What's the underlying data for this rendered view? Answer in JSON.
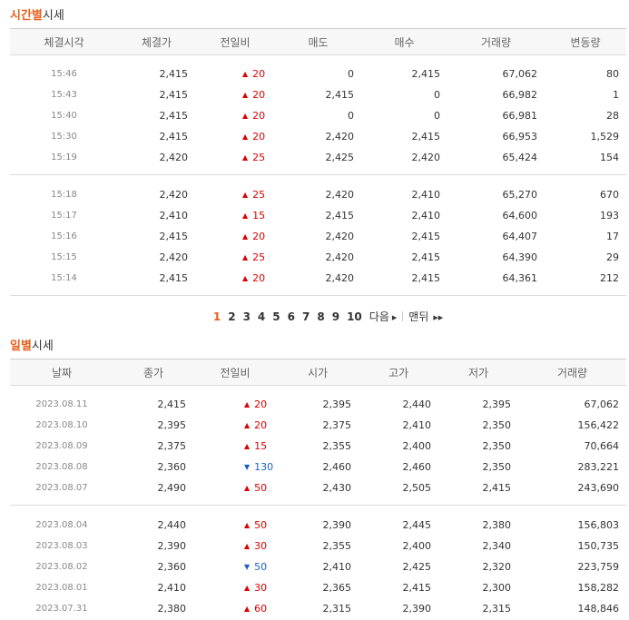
{
  "hourly": {
    "title_accent": "시간별",
    "title_rest": "시세",
    "headers": [
      "체결시각",
      "체결가",
      "전일비",
      "매도",
      "매수",
      "거래량",
      "변동량"
    ],
    "group1": [
      {
        "time": "15:46",
        "price": "2,415",
        "dir": "up",
        "chg": "20",
        "ask": "0",
        "bid": "2,415",
        "vol": "67,062",
        "delta": "80"
      },
      {
        "time": "15:43",
        "price": "2,415",
        "dir": "up",
        "chg": "20",
        "ask": "2,415",
        "bid": "0",
        "vol": "66,982",
        "delta": "1"
      },
      {
        "time": "15:40",
        "price": "2,415",
        "dir": "up",
        "chg": "20",
        "ask": "0",
        "bid": "0",
        "vol": "66,981",
        "delta": "28"
      },
      {
        "time": "15:30",
        "price": "2,415",
        "dir": "up",
        "chg": "20",
        "ask": "2,420",
        "bid": "2,415",
        "vol": "66,953",
        "delta": "1,529"
      },
      {
        "time": "15:19",
        "price": "2,420",
        "dir": "up",
        "chg": "25",
        "ask": "2,425",
        "bid": "2,420",
        "vol": "65,424",
        "delta": "154"
      }
    ],
    "group2": [
      {
        "time": "15:18",
        "price": "2,420",
        "dir": "up",
        "chg": "25",
        "ask": "2,420",
        "bid": "2,410",
        "vol": "65,270",
        "delta": "670"
      },
      {
        "time": "15:17",
        "price": "2,410",
        "dir": "up",
        "chg": "15",
        "ask": "2,415",
        "bid": "2,410",
        "vol": "64,600",
        "delta": "193"
      },
      {
        "time": "15:16",
        "price": "2,415",
        "dir": "up",
        "chg": "20",
        "ask": "2,420",
        "bid": "2,415",
        "vol": "64,407",
        "delta": "17"
      },
      {
        "time": "15:15",
        "price": "2,420",
        "dir": "up",
        "chg": "25",
        "ask": "2,420",
        "bid": "2,415",
        "vol": "64,390",
        "delta": "29"
      },
      {
        "time": "15:14",
        "price": "2,415",
        "dir": "up",
        "chg": "20",
        "ask": "2,420",
        "bid": "2,415",
        "vol": "64,361",
        "delta": "212"
      }
    ]
  },
  "pager": {
    "pages": [
      "1",
      "2",
      "3",
      "4",
      "5",
      "6",
      "7",
      "8",
      "9",
      "10"
    ],
    "current": "1",
    "next_label": "다음",
    "last_label": "맨뒤"
  },
  "daily": {
    "title_accent": "일별",
    "title_rest": "시세",
    "headers": [
      "날짜",
      "종가",
      "전일비",
      "시가",
      "고가",
      "저가",
      "거래량"
    ],
    "group1": [
      {
        "date": "2023.08.11",
        "close": "2,415",
        "dir": "up",
        "chg": "20",
        "open": "2,395",
        "high": "2,440",
        "low": "2,395",
        "vol": "67,062"
      },
      {
        "date": "2023.08.10",
        "close": "2,395",
        "dir": "up",
        "chg": "20",
        "open": "2,375",
        "high": "2,410",
        "low": "2,350",
        "vol": "156,422"
      },
      {
        "date": "2023.08.09",
        "close": "2,375",
        "dir": "up",
        "chg": "15",
        "open": "2,355",
        "high": "2,400",
        "low": "2,350",
        "vol": "70,664"
      },
      {
        "date": "2023.08.08",
        "close": "2,360",
        "dir": "down",
        "chg": "130",
        "open": "2,460",
        "high": "2,460",
        "low": "2,350",
        "vol": "283,221"
      },
      {
        "date": "2023.08.07",
        "close": "2,490",
        "dir": "up",
        "chg": "50",
        "open": "2,430",
        "high": "2,505",
        "low": "2,415",
        "vol": "243,690"
      }
    ],
    "group2": [
      {
        "date": "2023.08.04",
        "close": "2,440",
        "dir": "up",
        "chg": "50",
        "open": "2,390",
        "high": "2,445",
        "low": "2,380",
        "vol": "156,803"
      },
      {
        "date": "2023.08.03",
        "close": "2,390",
        "dir": "up",
        "chg": "30",
        "open": "2,355",
        "high": "2,400",
        "low": "2,340",
        "vol": "150,735"
      },
      {
        "date": "2023.08.02",
        "close": "2,360",
        "dir": "down",
        "chg": "50",
        "open": "2,410",
        "high": "2,425",
        "low": "2,320",
        "vol": "223,759"
      },
      {
        "date": "2023.08.01",
        "close": "2,410",
        "dir": "up",
        "chg": "30",
        "open": "2,365",
        "high": "2,415",
        "low": "2,300",
        "vol": "158,282"
      },
      {
        "date": "2023.07.31",
        "close": "2,380",
        "dir": "up",
        "chg": "60",
        "open": "2,315",
        "high": "2,390",
        "low": "2,315",
        "vol": "148,846"
      }
    ]
  },
  "colors": {
    "accent": "#e75f1c",
    "up": "#dd0000",
    "down": "#1a5fc7"
  },
  "icons": {
    "up": "triangle-up-icon",
    "down": "triangle-down-icon",
    "next": "arrow-right-icon",
    "last": "double-arrow-right-icon"
  }
}
